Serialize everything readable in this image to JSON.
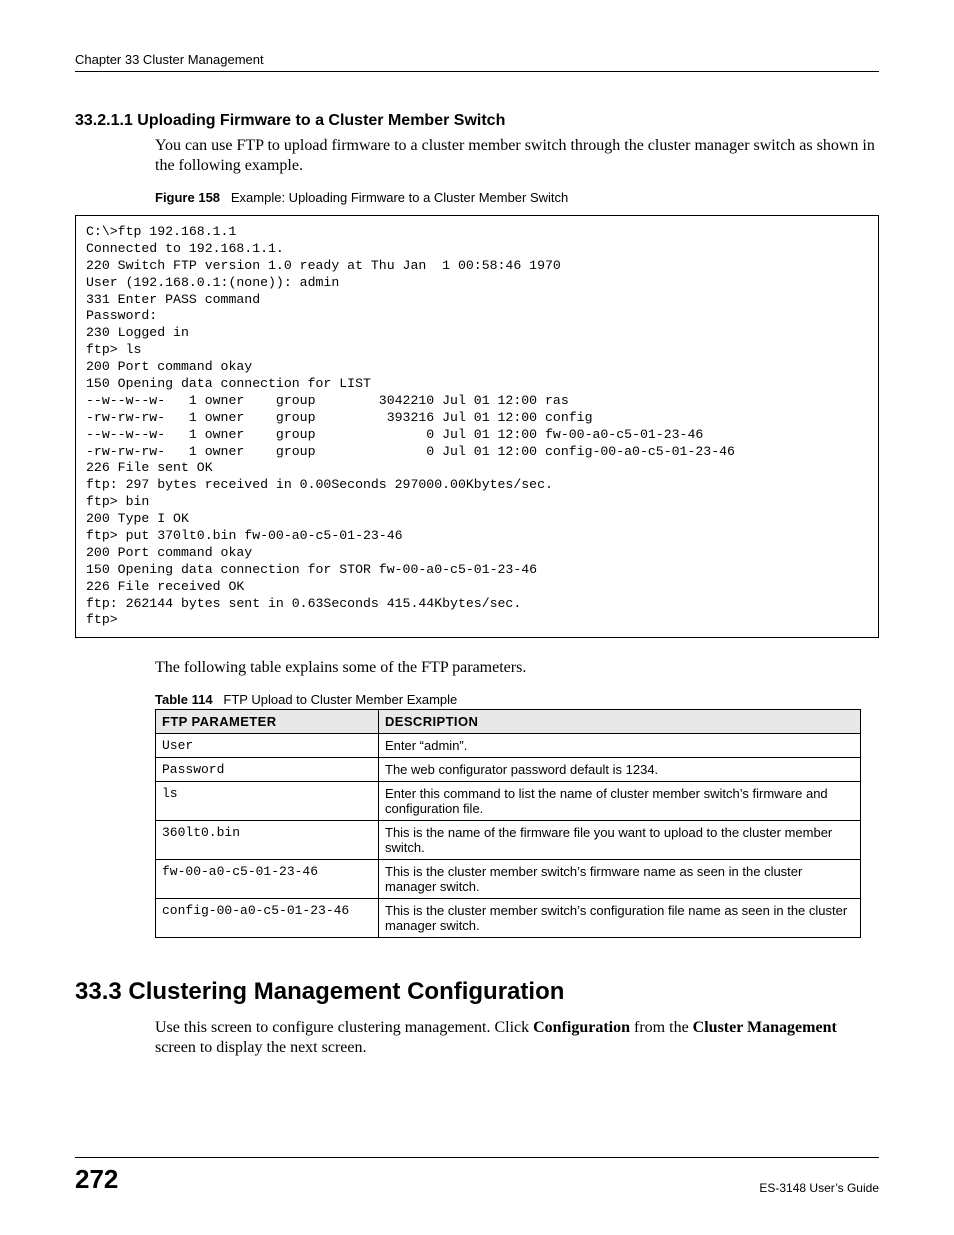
{
  "running_head": "Chapter 33 Cluster Management",
  "section_heading": "33.2.1.1  Uploading Firmware to a Cluster Member Switch",
  "intro_para": "You can use FTP to upload firmware to a cluster member switch through the cluster manager switch as shown in the following example.",
  "figure_label": "Figure 158",
  "figure_title": "Example: Uploading Firmware to a Cluster Member Switch",
  "code_block": "C:\\>ftp 192.168.1.1\nConnected to 192.168.1.1.\n220 Switch FTP version 1.0 ready at Thu Jan  1 00:58:46 1970\nUser (192.168.0.1:(none)): admin\n331 Enter PASS command\nPassword:\n230 Logged in\nftp> ls\n200 Port command okay\n150 Opening data connection for LIST\n--w--w--w-   1 owner    group        3042210 Jul 01 12:00 ras\n-rw-rw-rw-   1 owner    group         393216 Jul 01 12:00 config\n--w--w--w-   1 owner    group              0 Jul 01 12:00 fw-00-a0-c5-01-23-46\n-rw-rw-rw-   1 owner    group              0 Jul 01 12:00 config-00-a0-c5-01-23-46\n226 File sent OK\nftp: 297 bytes received in 0.00Seconds 297000.00Kbytes/sec.\nftp> bin\n200 Type I OK\nftp> put 370lt0.bin fw-00-a0-c5-01-23-46\n200 Port command okay\n150 Opening data connection for STOR fw-00-a0-c5-01-23-46\n226 File received OK\nftp: 262144 bytes sent in 0.63Seconds 415.44Kbytes/sec.\nftp>",
  "after_code_para": "The following table explains some of the FTP parameters.",
  "table_label": "Table 114",
  "table_title": "FTP Upload to Cluster Member Example",
  "table_header_param": "FTP PARAMETER",
  "table_header_desc": "DESCRIPTION",
  "table_rows": [
    {
      "param": "User",
      "desc": "Enter “admin”."
    },
    {
      "param": "Password",
      "desc": "The web configurator password default is 1234."
    },
    {
      "param": "ls",
      "desc": "Enter this command to list the name of cluster member switch’s firmware and configuration file."
    },
    {
      "param": "360lt0.bin",
      "desc": "This is the name of the firmware file you want to upload to the cluster member switch."
    },
    {
      "param": "fw-00-a0-c5-01-23-46",
      "desc": "This is the cluster member switch’s firmware name as seen in the cluster manager switch."
    },
    {
      "param": "config-00-a0-c5-01-23-46",
      "desc": "This is the cluster member switch’s configuration file name as seen in the cluster manager switch."
    }
  ],
  "h2_heading": "33.3  Clustering Management Configuration",
  "h2_para_pre": "Use this screen to configure clustering management. Click ",
  "h2_para_bold1": "Configuration",
  "h2_para_mid": " from the ",
  "h2_para_bold2": "Cluster Management",
  "h2_para_post": " screen to display the next screen.",
  "page_number": "272",
  "guide_name": "ES-3148 User’s Guide"
}
